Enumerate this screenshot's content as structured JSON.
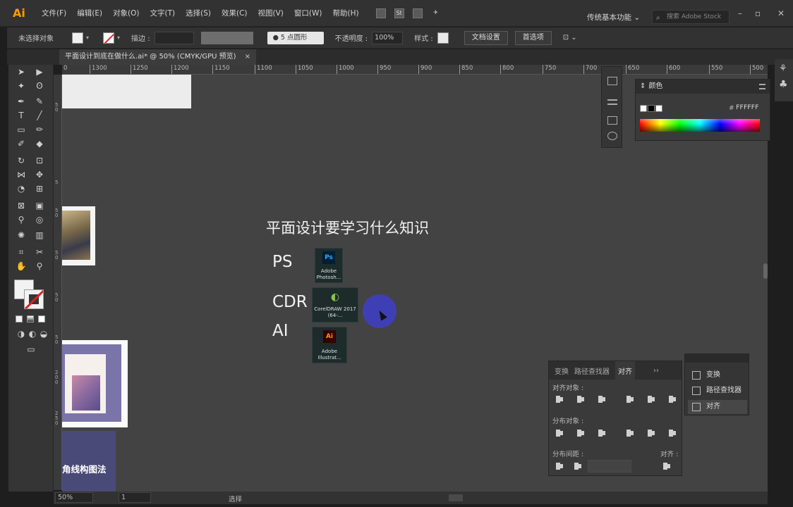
{
  "menubar": {
    "logo": "Ai",
    "items": [
      "文件(F)",
      "编辑(E)",
      "对象(O)",
      "文字(T)",
      "选择(S)",
      "效果(C)",
      "视图(V)",
      "窗口(W)",
      "帮助(H)"
    ],
    "workspace": "传统基本功能",
    "search_placeholder": "搜索 Adobe Stock"
  },
  "controlbar": {
    "selection": "未选择对象",
    "stroke_label": "描边 :",
    "brush": "5 点圆形",
    "opacity_label": "不透明度 :",
    "opacity_value": "100%",
    "style_label": "样式 :",
    "doc_setup": "文档设置",
    "preferences": "首选项"
  },
  "document": {
    "tab_title": "平面设计到底在做什么.ai* @ 50% (CMYK/GPU 预览)",
    "close": "×"
  },
  "ruler": {
    "top_ticks": [
      "0",
      "1300",
      "1250",
      "1200",
      "1150",
      "1100",
      "1050",
      "1000",
      "950",
      "900",
      "850",
      "800",
      "750",
      "700",
      "650",
      "600",
      "550",
      "500"
    ],
    "left_ticks": [
      "5 0",
      "5",
      "5 0",
      "5 0",
      "5 0",
      "5 0",
      "2 0 0",
      "2 5 0"
    ]
  },
  "canvas": {
    "title": "平面设计要学习什么知识",
    "labels": [
      "PS",
      "CDR",
      "AI"
    ],
    "icons": [
      {
        "glyph": "Ps",
        "caption": "Adobe Photosh...",
        "color": "#31a8ff"
      },
      {
        "glyph": "◐",
        "caption": "CorelDRAW 2017 (64-...",
        "color": "#8bc34a"
      },
      {
        "glyph": "Ai",
        "caption": "Adobe Illustrat...",
        "color": "#ff9a00"
      }
    ],
    "side_text": "角线构图法"
  },
  "color_panel": {
    "title": "颜色",
    "hex_prefix": "#",
    "hex_value": "FFFFFF"
  },
  "align_panel": {
    "tabs": [
      "变换",
      "路径查找器",
      "对齐"
    ],
    "align_objects": "对齐对象 :",
    "distribute_objects": "分布对象 :",
    "distribute_spacing": "分布间距 :",
    "align_to": "对齐 :"
  },
  "collapsed_panel": {
    "items": [
      "变换",
      "路径查找器",
      "对齐"
    ]
  },
  "statusbar": {
    "zoom": "50%",
    "page": "1",
    "tool": "选择"
  }
}
